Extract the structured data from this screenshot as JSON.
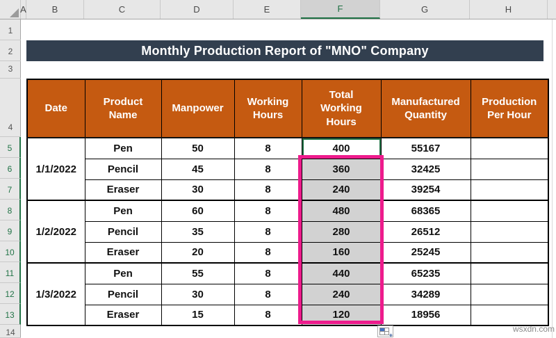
{
  "spreadsheet": {
    "column_headers": [
      "A",
      "B",
      "C",
      "D",
      "E",
      "F",
      "G",
      "H"
    ],
    "selected_column": "F",
    "row_headers": [
      "1",
      "2",
      "3",
      "4",
      "5",
      "6",
      "7",
      "8",
      "9",
      "10",
      "11",
      "12",
      "13",
      "14"
    ],
    "selected_rows": [
      "5",
      "6",
      "7",
      "8",
      "9",
      "10",
      "11",
      "12",
      "13"
    ]
  },
  "banner": {
    "title": "Monthly Production Report of \"MNO\" Company"
  },
  "table": {
    "headers": [
      "Date",
      "Product\nName",
      "Manpower",
      "Working\nHours",
      "Total\nWorking\nHours",
      "Manufactured\nQuantity",
      "Production\nPer Hour"
    ],
    "groups": [
      {
        "date": "1/1/2022",
        "rows": [
          {
            "product": "Pen",
            "manpower": "50",
            "working_hours": "8",
            "total_working_hours": "400",
            "manufactured_quantity": "55167",
            "production_per_hour": ""
          },
          {
            "product": "Pencil",
            "manpower": "45",
            "working_hours": "8",
            "total_working_hours": "360",
            "manufactured_quantity": "32425",
            "production_per_hour": ""
          },
          {
            "product": "Eraser",
            "manpower": "30",
            "working_hours": "8",
            "total_working_hours": "240",
            "manufactured_quantity": "39254",
            "production_per_hour": ""
          }
        ]
      },
      {
        "date": "1/2/2022",
        "rows": [
          {
            "product": "Pen",
            "manpower": "60",
            "working_hours": "8",
            "total_working_hours": "480",
            "manufactured_quantity": "68365",
            "production_per_hour": ""
          },
          {
            "product": "Pencil",
            "manpower": "35",
            "working_hours": "8",
            "total_working_hours": "280",
            "manufactured_quantity": "26512",
            "production_per_hour": ""
          },
          {
            "product": "Eraser",
            "manpower": "20",
            "working_hours": "8",
            "total_working_hours": "160",
            "manufactured_quantity": "25245",
            "production_per_hour": ""
          }
        ]
      },
      {
        "date": "1/3/2022",
        "rows": [
          {
            "product": "Pen",
            "manpower": "55",
            "working_hours": "8",
            "total_working_hours": "440",
            "manufactured_quantity": "65235",
            "production_per_hour": ""
          },
          {
            "product": "Pencil",
            "manpower": "30",
            "working_hours": "8",
            "total_working_hours": "240",
            "manufactured_quantity": "34289",
            "production_per_hour": ""
          },
          {
            "product": "Eraser",
            "manpower": "15",
            "working_hours": "8",
            "total_working_hours": "120",
            "manufactured_quantity": "18956",
            "production_per_hour": ""
          }
        ]
      }
    ],
    "selection": {
      "active_cell_value": "400",
      "selected_range_values": [
        "360",
        "240",
        "480",
        "280",
        "160",
        "440",
        "240",
        "120"
      ]
    }
  },
  "colors": {
    "header_fill": "#C55A11",
    "banner_bg": "#323F4F",
    "selection_fill": "#D2D2D2",
    "annotation_pink": "#ED1B8C",
    "excel_green": "#217346"
  },
  "watermark": "wsxdn.com"
}
